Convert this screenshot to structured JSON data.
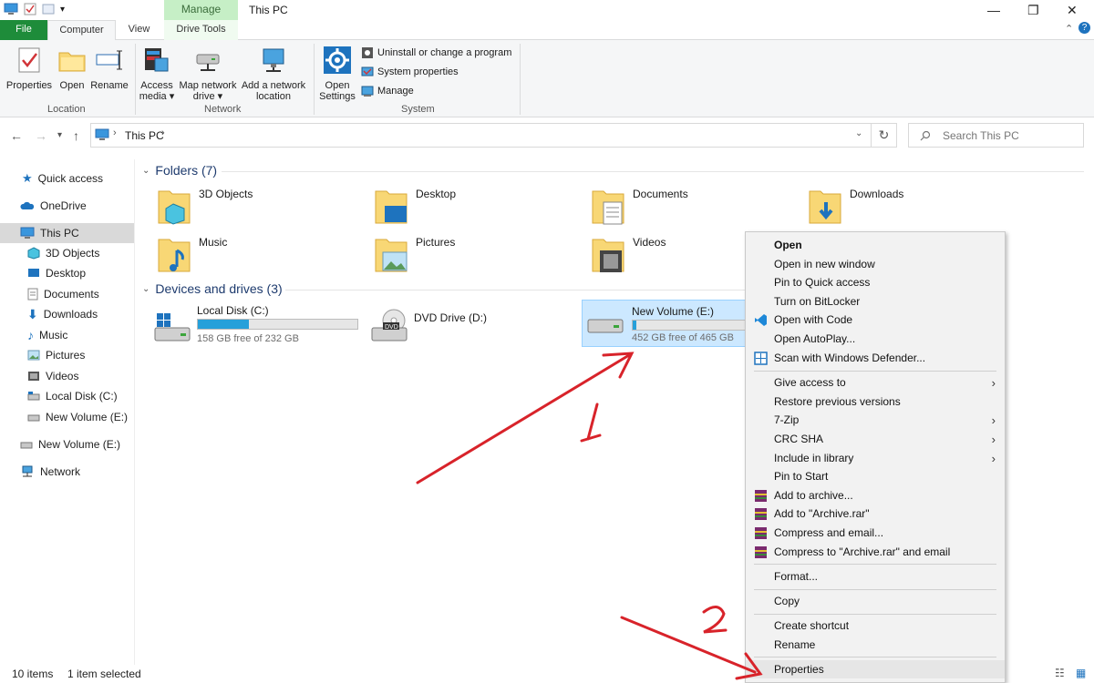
{
  "window": {
    "title": "This PC",
    "context_tab_group": "Manage"
  },
  "ribbon_tabs": [
    "File",
    "Computer",
    "View",
    "Drive Tools"
  ],
  "ribbon": {
    "location": {
      "label": "Location",
      "buttons": [
        "Properties",
        "Open",
        "Rename"
      ]
    },
    "network": {
      "label": "Network",
      "buttons": [
        {
          "line1": "Access",
          "line2": "media ▾"
        },
        {
          "line1": "Map network",
          "line2": "drive ▾"
        },
        {
          "line1": "Add a network",
          "line2": "location"
        }
      ]
    },
    "system": {
      "label": "System",
      "open_settings": {
        "line1": "Open",
        "line2": "Settings"
      },
      "small_buttons": [
        "Uninstall or change a program",
        "System properties",
        "Manage"
      ]
    }
  },
  "address": {
    "path": "This PC",
    "search_placeholder": "Search This PC"
  },
  "nav_pane": [
    {
      "label": "Quick access",
      "icon": "star-icon"
    },
    {
      "label": "OneDrive",
      "icon": "cloud-icon"
    },
    {
      "label": "This PC",
      "icon": "computer-icon",
      "selected": true
    },
    {
      "label": "3D Objects",
      "icon": "cube-icon"
    },
    {
      "label": "Desktop",
      "icon": "desktop-icon"
    },
    {
      "label": "Documents",
      "icon": "document-icon"
    },
    {
      "label": "Downloads",
      "icon": "download-icon"
    },
    {
      "label": "Music",
      "icon": "music-icon"
    },
    {
      "label": "Pictures",
      "icon": "picture-icon"
    },
    {
      "label": "Videos",
      "icon": "video-icon"
    },
    {
      "label": "Local Disk (C:)",
      "icon": "drive-icon"
    },
    {
      "label": "New Volume (E:)",
      "icon": "drive-icon"
    },
    {
      "label": "New Volume (E:)",
      "icon": "drive-icon"
    },
    {
      "label": "Network",
      "icon": "network-icon"
    }
  ],
  "folders": {
    "heading": "Folders (7)",
    "items": [
      "3D Objects",
      "Desktop",
      "Documents",
      "Downloads",
      "Music",
      "Pictures",
      "Videos"
    ]
  },
  "drives": {
    "heading": "Devices and drives (3)",
    "items": [
      {
        "name": "Local Disk (C:)",
        "free": "158 GB free of 232 GB",
        "used_fraction": 0.32
      },
      {
        "name": "DVD Drive (D:)",
        "free": "",
        "used_fraction": null
      },
      {
        "name": "New Volume (E:)",
        "free": "452 GB free of 465 GB",
        "used_fraction": 0.03,
        "selected": true
      }
    ]
  },
  "context_menu": [
    "Open",
    "Open in new window",
    "Pin to Quick access",
    "Turn on BitLocker",
    "Open with Code",
    "Open AutoPlay...",
    "Scan with Windows Defender...",
    "Give access to",
    "Restore previous versions",
    "7-Zip",
    "CRC SHA",
    "Include in library",
    "Pin to Start",
    "Add to archive...",
    "Add to \"Archive.rar\"",
    "Compress and email...",
    "Compress to \"Archive.rar\" and email",
    "Format...",
    "Copy",
    "Create shortcut",
    "Rename",
    "Properties"
  ],
  "status": {
    "items": "10 items",
    "selected": "1 item selected"
  },
  "annotations": {
    "step1": "1",
    "step2": "2",
    "color": "#d8232a"
  },
  "colors": {
    "file_tab": "#1e8c3a",
    "context_tab": "#c6efc6",
    "progress": "#26a0da",
    "selection": "#cce8ff"
  }
}
